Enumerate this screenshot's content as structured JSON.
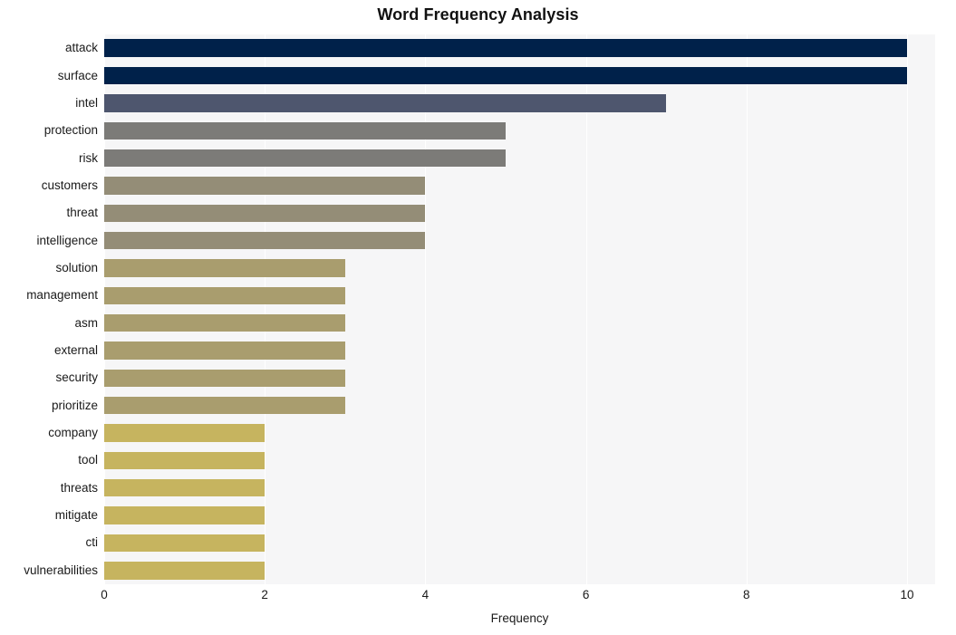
{
  "chart_data": {
    "type": "bar",
    "orientation": "horizontal",
    "title": "Word Frequency Analysis",
    "xlabel": "Frequency",
    "ylabel": "",
    "categories": [
      "attack",
      "surface",
      "intel",
      "protection",
      "risk",
      "customers",
      "threat",
      "intelligence",
      "solution",
      "management",
      "asm",
      "external",
      "security",
      "prioritize",
      "company",
      "tool",
      "threats",
      "mitigate",
      "cti",
      "vulnerabilities"
    ],
    "values": [
      10,
      10,
      7,
      5,
      5,
      4,
      4,
      4,
      3,
      3,
      3,
      3,
      3,
      3,
      2,
      2,
      2,
      2,
      2,
      2
    ],
    "bar_colors": [
      "#00214a",
      "#00214a",
      "#4e566e",
      "#7c7b78",
      "#7c7b78",
      "#948d77",
      "#948d77",
      "#948d77",
      "#a99d6e",
      "#a99d6e",
      "#a99d6e",
      "#a99d6e",
      "#a99d6e",
      "#a99d6e",
      "#c6b45f",
      "#c6b45f",
      "#c6b45f",
      "#c6b45f",
      "#c6b45f",
      "#c6b45f"
    ],
    "xlim": [
      0,
      10.35
    ],
    "xticks": [
      0,
      2,
      4,
      6,
      8,
      10
    ],
    "xtick_labels": [
      "0",
      "2",
      "4",
      "6",
      "8",
      "10"
    ],
    "grid": true,
    "grid_color": "#ffffff",
    "grid_axis": "x",
    "plot_background": "#f6f6f7",
    "figure_background": "#ffffff",
    "legend": null,
    "annotations": []
  }
}
